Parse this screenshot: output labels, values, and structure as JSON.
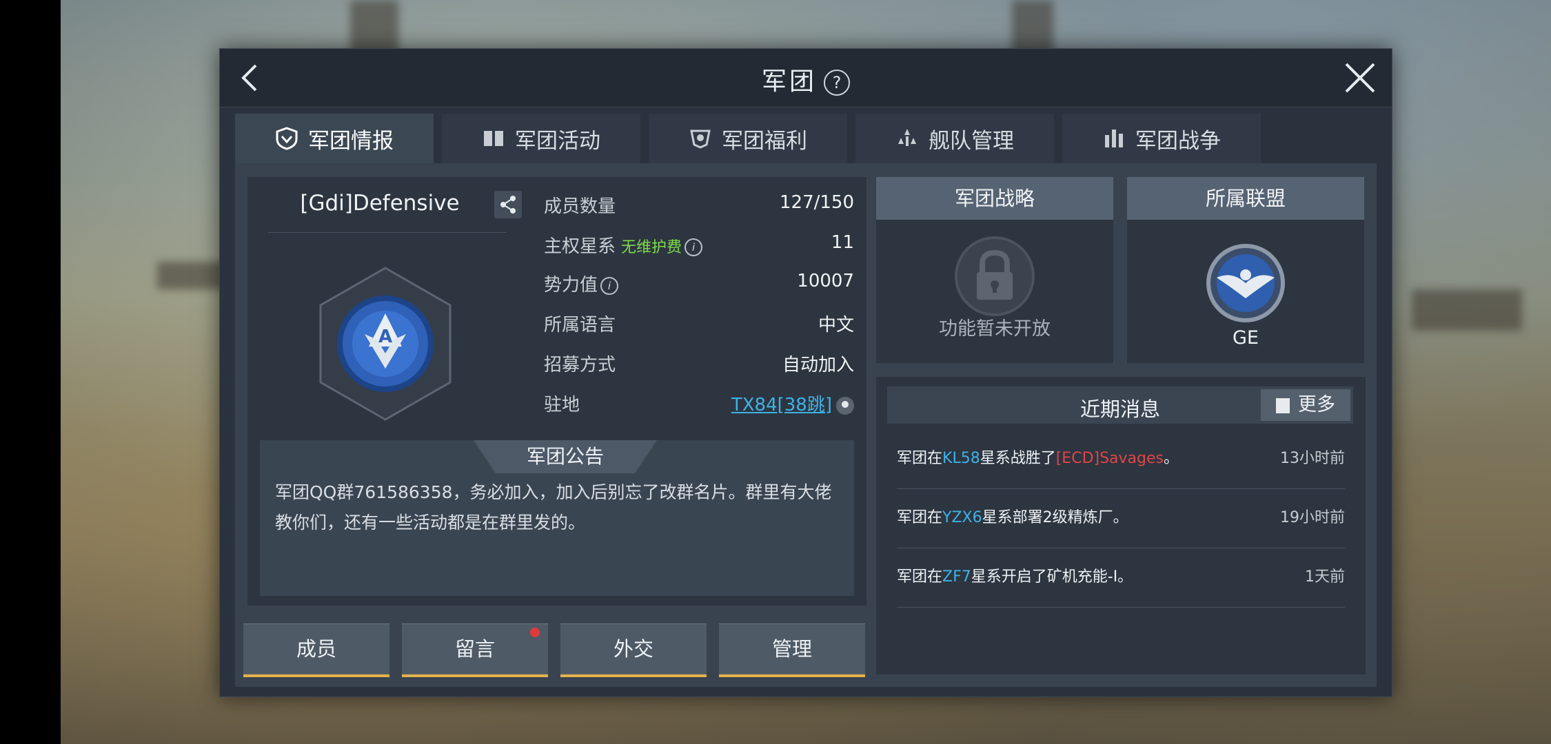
{
  "header": {
    "title": "军团",
    "help": "?"
  },
  "tabs": [
    {
      "label": "军团情报",
      "icon": "shield-icon"
    },
    {
      "label": "军团活动",
      "icon": "book-icon"
    },
    {
      "label": "军团福利",
      "icon": "gift-badge-icon"
    },
    {
      "label": "舰队管理",
      "icon": "fleet-icon"
    },
    {
      "label": "军团战争",
      "icon": "war-icon"
    }
  ],
  "guild": {
    "name": "[Gdi]Defensive",
    "rows": [
      {
        "label": "成员数量",
        "value": "127/150"
      },
      {
        "label": "主权星系",
        "sub": "无维护费",
        "value": "11"
      },
      {
        "label": "势力值",
        "value": "10007"
      },
      {
        "label": "所属语言",
        "value": "中文"
      },
      {
        "label": "招募方式",
        "value": "自动加入"
      },
      {
        "label": "驻地",
        "value": "TX84[38跳]"
      }
    ]
  },
  "notice": {
    "title": "军团公告",
    "text": "军团QQ群761586358，务必加入，加入后别忘了改群名片。群里有大佬教你们，还有一些活动都是在群里发的。"
  },
  "buttons": {
    "members": "成员",
    "messages": "留言",
    "diplomacy": "外交",
    "manage": "管理"
  },
  "strategy": {
    "title": "军团战略",
    "locked": "功能暂未开放"
  },
  "alliance": {
    "title": "所属联盟",
    "name": "GE"
  },
  "news": {
    "title": "近期消息",
    "more": "更多",
    "items": [
      {
        "pre": "军团在",
        "sys": "KL58",
        "mid": "星系战胜了",
        "target": "[ECD]Savages",
        "post": "。",
        "time": "13小时前"
      },
      {
        "pre": "军团在",
        "sys": "YZX6",
        "mid": "星系部署2级精炼厂。",
        "target": "",
        "post": "",
        "time": "19小时前"
      },
      {
        "pre": "军团在",
        "sys": "ZF7",
        "mid": "星系开启了矿机充能-I。",
        "target": "",
        "post": "",
        "time": "1天前"
      }
    ]
  },
  "colors": {
    "accent": "#e2b24a",
    "link": "#3fb2e6",
    "green": "#7ddc4a",
    "red": "#e04545"
  }
}
